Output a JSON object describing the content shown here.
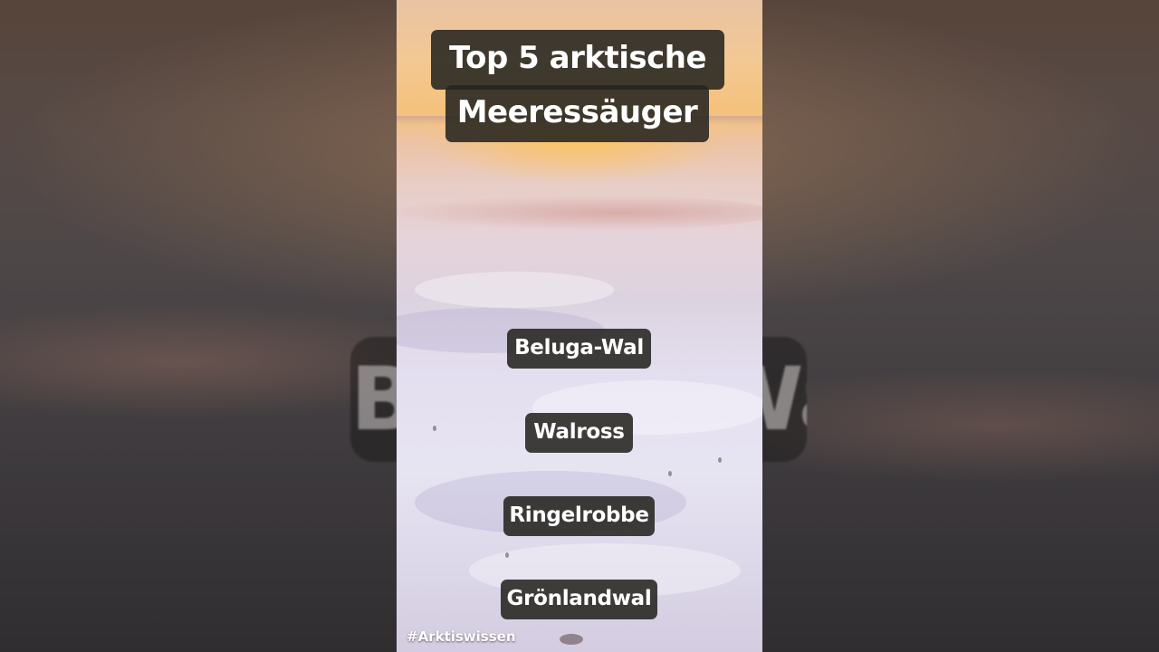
{
  "video": {
    "title_line1": "Top 5 arktische",
    "title_line2": "Meeressäuger",
    "items": [
      "Beluga-Wal",
      "Walross",
      "Ringelrobbe",
      "Grönlandwal"
    ],
    "hashtag": "#Arktiswissen"
  },
  "colors": {
    "caption_background": "#26241f",
    "caption_text": "#ffffff",
    "sunset_glow": "#f5c27c",
    "snow": "#e7e4f2"
  }
}
